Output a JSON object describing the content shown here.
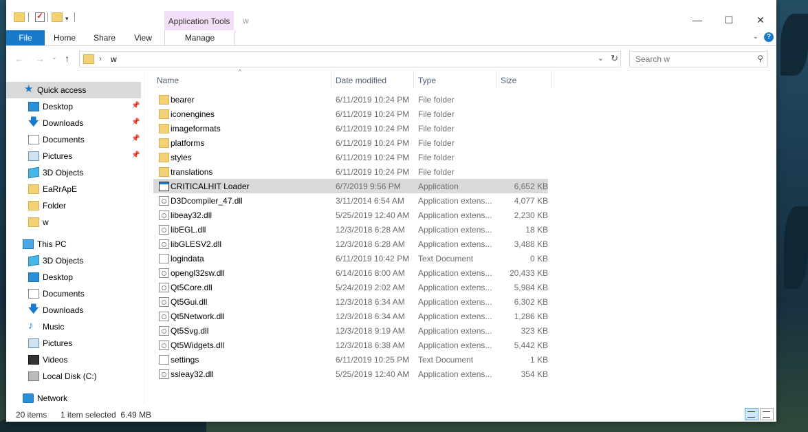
{
  "window": {
    "title": "w",
    "context_tab_group": "Application Tools",
    "controls": [
      "—",
      "☐",
      "✕"
    ]
  },
  "ribbon": {
    "tabs": [
      "File",
      "Home",
      "Share",
      "View",
      "Manage"
    ],
    "help": "?"
  },
  "address": {
    "path": "w",
    "separator": "›",
    "search_placeholder": "Search w"
  },
  "nav": {
    "quick_access": "Quick access",
    "quick_items": [
      {
        "label": "Desktop",
        "icon": "desktop-icon",
        "pinned": true
      },
      {
        "label": "Downloads",
        "icon": "downloads-icon",
        "pinned": true
      },
      {
        "label": "Documents",
        "icon": "documents-icon",
        "pinned": true
      },
      {
        "label": "Pictures",
        "icon": "pictures-icon",
        "pinned": true
      },
      {
        "label": "3D Objects",
        "icon": "3d-objects-icon",
        "pinned": false
      },
      {
        "label": "EaRrApE",
        "icon": "folder-icon",
        "pinned": false
      },
      {
        "label": "Folder",
        "icon": "folder-icon",
        "pinned": false
      },
      {
        "label": "w",
        "icon": "folder-icon",
        "pinned": false
      }
    ],
    "this_pc": "This PC",
    "pc_items": [
      {
        "label": "3D Objects",
        "icon": "3d-objects-icon"
      },
      {
        "label": "Desktop",
        "icon": "desktop-icon"
      },
      {
        "label": "Documents",
        "icon": "documents-icon"
      },
      {
        "label": "Downloads",
        "icon": "downloads-icon"
      },
      {
        "label": "Music",
        "icon": "music-icon"
      },
      {
        "label": "Pictures",
        "icon": "pictures-icon"
      },
      {
        "label": "Videos",
        "icon": "videos-icon"
      },
      {
        "label": "Local Disk (C:)",
        "icon": "local-disk-icon"
      }
    ],
    "network": "Network"
  },
  "columns": {
    "name": "Name",
    "date": "Date modified",
    "type": "Type",
    "size": "Size"
  },
  "files": [
    {
      "name": "bearer",
      "date": "6/11/2019 10:24 PM",
      "type": "File folder",
      "size": "",
      "kind": "folder"
    },
    {
      "name": "iconengines",
      "date": "6/11/2019 10:24 PM",
      "type": "File folder",
      "size": "",
      "kind": "folder"
    },
    {
      "name": "imageformats",
      "date": "6/11/2019 10:24 PM",
      "type": "File folder",
      "size": "",
      "kind": "folder"
    },
    {
      "name": "platforms",
      "date": "6/11/2019 10:24 PM",
      "type": "File folder",
      "size": "",
      "kind": "folder"
    },
    {
      "name": "styles",
      "date": "6/11/2019 10:24 PM",
      "type": "File folder",
      "size": "",
      "kind": "folder"
    },
    {
      "name": "translations",
      "date": "6/11/2019 10:24 PM",
      "type": "File folder",
      "size": "",
      "kind": "folder"
    },
    {
      "name": "CRITICALHIT Loader",
      "date": "6/7/2019 9:56 PM",
      "type": "Application",
      "size": "6,652 KB",
      "kind": "app",
      "selected": true
    },
    {
      "name": "D3Dcompiler_47.dll",
      "date": "3/11/2014 6:54 AM",
      "type": "Application extens...",
      "size": "4,077 KB",
      "kind": "dll"
    },
    {
      "name": "libeay32.dll",
      "date": "5/25/2019 12:40 AM",
      "type": "Application extens...",
      "size": "2,230 KB",
      "kind": "dll"
    },
    {
      "name": "libEGL.dll",
      "date": "12/3/2018 6:28 AM",
      "type": "Application extens...",
      "size": "18 KB",
      "kind": "dll"
    },
    {
      "name": "libGLESV2.dll",
      "date": "12/3/2018 6:28 AM",
      "type": "Application extens...",
      "size": "3,488 KB",
      "kind": "dll"
    },
    {
      "name": "logindata",
      "date": "6/11/2019 10:42 PM",
      "type": "Text Document",
      "size": "0 KB",
      "kind": "file"
    },
    {
      "name": "opengl32sw.dll",
      "date": "6/14/2016 8:00 AM",
      "type": "Application extens...",
      "size": "20,433 KB",
      "kind": "dll"
    },
    {
      "name": "Qt5Core.dll",
      "date": "5/24/2019 2:02 AM",
      "type": "Application extens...",
      "size": "5,984 KB",
      "kind": "dll"
    },
    {
      "name": "Qt5Gui.dll",
      "date": "12/3/2018 6:34 AM",
      "type": "Application extens...",
      "size": "6,302 KB",
      "kind": "dll"
    },
    {
      "name": "Qt5Network.dll",
      "date": "12/3/2018 6:34 AM",
      "type": "Application extens...",
      "size": "1,286 KB",
      "kind": "dll"
    },
    {
      "name": "Qt5Svg.dll",
      "date": "12/3/2018 9:19 AM",
      "type": "Application extens...",
      "size": "323 KB",
      "kind": "dll"
    },
    {
      "name": "Qt5Widgets.dll",
      "date": "12/3/2018 6:38 AM",
      "type": "Application extens...",
      "size": "5,442 KB",
      "kind": "dll"
    },
    {
      "name": "settings",
      "date": "6/11/2019 10:25 PM",
      "type": "Text Document",
      "size": "1 KB",
      "kind": "file"
    },
    {
      "name": "ssleay32.dll",
      "date": "5/25/2019 12:40 AM",
      "type": "Application extens...",
      "size": "354 KB",
      "kind": "dll"
    }
  ],
  "status": {
    "count": "20 items",
    "selection": "1 item selected  6.49 MB"
  },
  "colors": {
    "accent": "#1979ca",
    "context_tab": "#f3dff7",
    "selection": "#d9d9d9"
  }
}
